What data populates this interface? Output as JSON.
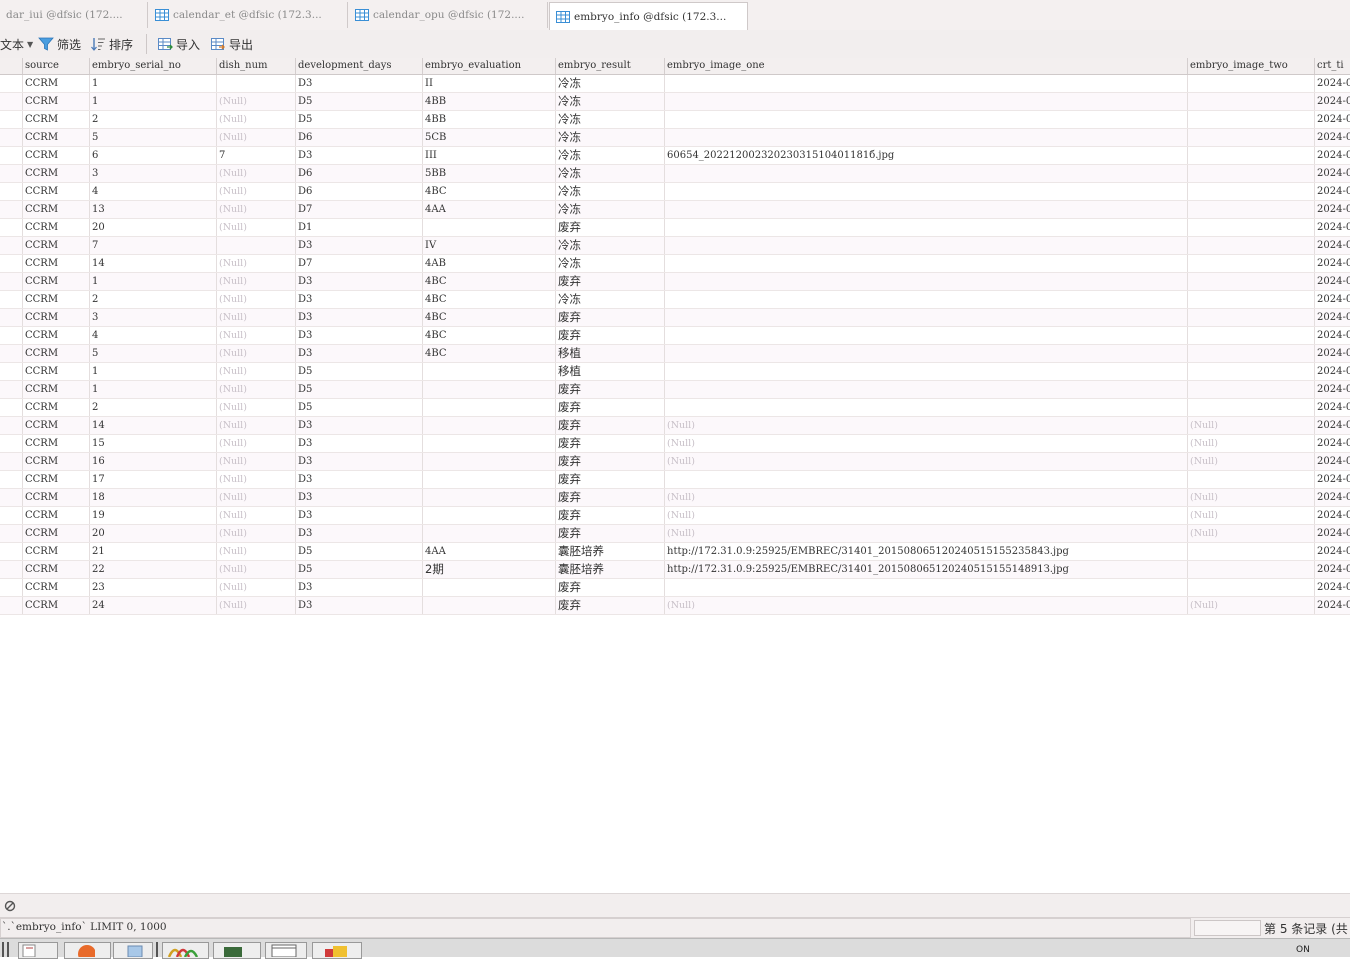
{
  "tabs": [
    {
      "label": "dar_iui @dfsic (172...."
    },
    {
      "label": "calendar_et @dfsic (172.3..."
    },
    {
      "label": "calendar_opu @dfsic (172...."
    },
    {
      "label": "embryo_info @dfsic (172.3..."
    }
  ],
  "toolbar": {
    "text_label": "文本",
    "filter_label": "筛选",
    "sort_label": "排序",
    "import_label": "导入",
    "export_label": "导出"
  },
  "columns": [
    "source",
    "embryo_serial_no",
    "dish_num",
    "development_days",
    "embryo_evaluation",
    "embryo_result",
    "embryo_image_one",
    "embryo_image_two",
    "crt_ti"
  ],
  "rows": [
    [
      "CCRM",
      "1",
      "",
      "D3",
      "II",
      "冷冻",
      "",
      "",
      "2024-0"
    ],
    [
      "CCRM",
      "1",
      "(Null)",
      "D5",
      "4BB",
      "冷冻",
      "",
      "",
      "2024-0"
    ],
    [
      "CCRM",
      "2",
      "(Null)",
      "D5",
      "4BB",
      "冷冻",
      "",
      "",
      "2024-0"
    ],
    [
      "CCRM",
      "5",
      "(Null)",
      "D6",
      "5CB",
      "冷冻",
      "",
      "",
      "2024-0"
    ],
    [
      "CCRM",
      "6",
      "7",
      "D3",
      "III",
      "冷冻",
      "60654_20221200232023031510401181б.jpg",
      "",
      "2024-0"
    ],
    [
      "CCRM",
      "3",
      "(Null)",
      "D6",
      "5BB",
      "冷冻",
      "",
      "",
      "2024-0"
    ],
    [
      "CCRM",
      "4",
      "(Null)",
      "D6",
      "4BC",
      "冷冻",
      "",
      "",
      "2024-0"
    ],
    [
      "CCRM",
      "13",
      "(Null)",
      "D7",
      "4AA",
      "冷冻",
      "",
      "",
      "2024-0"
    ],
    [
      "CCRM",
      "20",
      "(Null)",
      "D1",
      "",
      "废弃",
      "",
      "",
      "2024-0"
    ],
    [
      "CCRM",
      "7",
      "",
      "D3",
      "IV",
      "冷冻",
      "",
      "",
      "2024-0"
    ],
    [
      "CCRM",
      "14",
      "(Null)",
      "D7",
      "4AB",
      "冷冻",
      "",
      "",
      "2024-0"
    ],
    [
      "CCRM",
      "1",
      "(Null)",
      "D3",
      "4BC",
      "废弃",
      "",
      "",
      "2024-0"
    ],
    [
      "CCRM",
      "2",
      "(Null)",
      "D3",
      "4BC",
      "冷冻",
      "",
      "",
      "2024-0"
    ],
    [
      "CCRM",
      "3",
      "(Null)",
      "D3",
      "4BC",
      "废弃",
      "",
      "",
      "2024-0"
    ],
    [
      "CCRM",
      "4",
      "(Null)",
      "D3",
      "4BC",
      "废弃",
      "",
      "",
      "2024-0"
    ],
    [
      "CCRM",
      "5",
      "(Null)",
      "D3",
      "4BC",
      "移植",
      "",
      "",
      "2024-0"
    ],
    [
      "CCRM",
      "1",
      "(Null)",
      "D5",
      "",
      "移植",
      "",
      "",
      "2024-0"
    ],
    [
      "CCRM",
      "1",
      "(Null)",
      "D5",
      "",
      "废弃",
      "",
      "",
      "2024-0"
    ],
    [
      "CCRM",
      "2",
      "(Null)",
      "D5",
      "",
      "废弃",
      "",
      "",
      "2024-0"
    ],
    [
      "CCRM",
      "14",
      "(Null)",
      "D3",
      "",
      "废弃",
      "(Null)",
      "(Null)",
      "2024-0"
    ],
    [
      "CCRM",
      "15",
      "(Null)",
      "D3",
      "",
      "废弃",
      "(Null)",
      "(Null)",
      "2024-0"
    ],
    [
      "CCRM",
      "16",
      "(Null)",
      "D3",
      "",
      "废弃",
      "(Null)",
      "(Null)",
      "2024-0"
    ],
    [
      "CCRM",
      "17",
      "(Null)",
      "D3",
      "",
      "废弃",
      "",
      "",
      "2024-0"
    ],
    [
      "CCRM",
      "18",
      "(Null)",
      "D3",
      "",
      "废弃",
      "(Null)",
      "(Null)",
      "2024-0"
    ],
    [
      "CCRM",
      "19",
      "(Null)",
      "D3",
      "",
      "废弃",
      "(Null)",
      "(Null)",
      "2024-0"
    ],
    [
      "CCRM",
      "20",
      "(Null)",
      "D3",
      "",
      "废弃",
      "(Null)",
      "(Null)",
      "2024-0"
    ],
    [
      "CCRM",
      "21",
      "(Null)",
      "D5",
      "4AA",
      "囊胚培养",
      "http://172.31.0.9:25925/EMBREC/31401_20150806512024051515523584З.jpg",
      "",
      "2024-0"
    ],
    [
      "CCRM",
      "22",
      "(Null)",
      "D5",
      "2期",
      "囊胚培养",
      "http://172.31.0.9:25925/EMBREC/31401_20150806512024051515514891З.jpg",
      "",
      "2024-0"
    ],
    [
      "CCRM",
      "23",
      "(Null)",
      "D3",
      "",
      "废弃",
      "",
      "",
      "2024-0"
    ],
    [
      "CCRM",
      "24",
      "(Null)",
      "D3",
      "",
      "废弃",
      "(Null)",
      "(Null)",
      "2024-0"
    ]
  ],
  "status": {
    "sql": "`.`embryo_info` LIMIT 0, 1000",
    "record_count": "第 5 条记录 (共"
  },
  "colors": {
    "tab_icon": "#3a8fd6",
    "null_text": "#c8c0c8",
    "alt_row": "#fcf8fb"
  }
}
